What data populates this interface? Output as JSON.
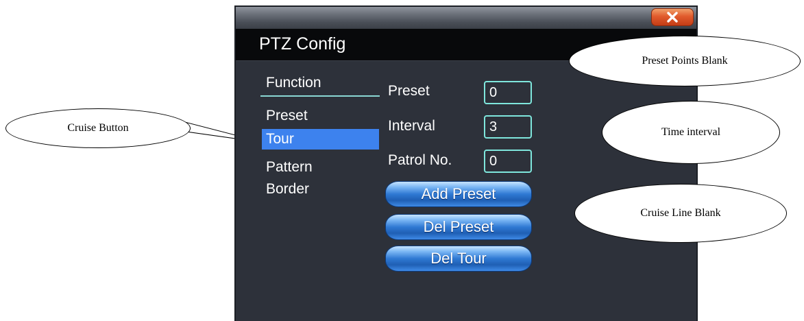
{
  "window": {
    "title": "PTZ Config",
    "close_label": "close"
  },
  "menu": {
    "items": [
      "Function",
      "Preset",
      "Tour",
      "Pattern",
      "Border"
    ],
    "selected": "Tour"
  },
  "fields": {
    "preset": {
      "label": "Preset",
      "value": "0"
    },
    "interval": {
      "label": "Interval",
      "value": "3"
    },
    "patrol": {
      "label": "Patrol No.",
      "value": "0"
    }
  },
  "buttons": {
    "add_preset": "Add Preset",
    "del_preset": "Del Preset",
    "del_tour": "Del Tour"
  },
  "callouts": {
    "preset_points": "Preset Points Blank",
    "time_interval": "Time interval",
    "cruise_line": "Cruise Line Blank",
    "cruise_button": "Cruise Button"
  },
  "colors": {
    "window_bg": "#2d313a",
    "header_bg": "#08090b",
    "selected_bg": "#3d82ee",
    "field_border": "#7fe7dd",
    "close_btn": "#e15b2d",
    "button_blue": "#2f79d3"
  }
}
